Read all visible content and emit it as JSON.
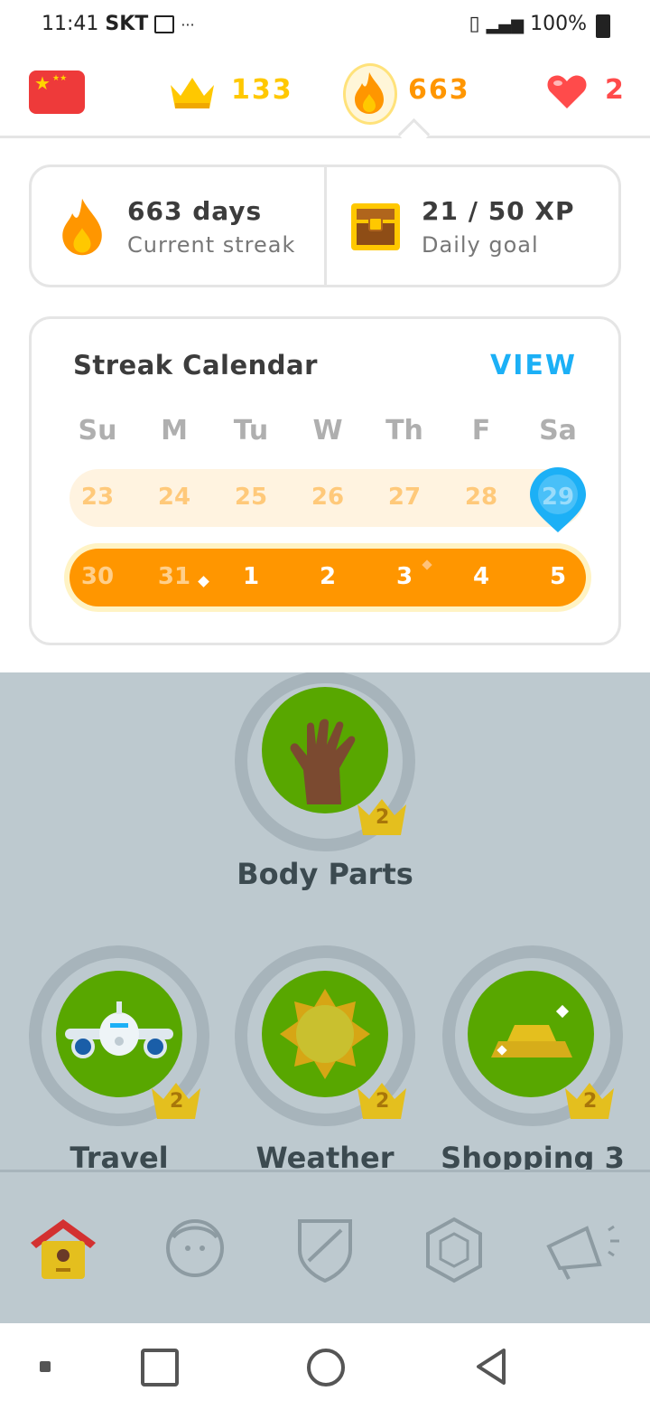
{
  "status": {
    "time": "11:41",
    "carrier": "SKT",
    "battery": "100%"
  },
  "top": {
    "crowns": "133",
    "streak": "663",
    "hearts": "2"
  },
  "streak_card": {
    "days": "663 days",
    "days_label": "Current streak",
    "xp": "21 / 50 XP",
    "xp_label": "Daily goal"
  },
  "calendar": {
    "title": "Streak Calendar",
    "view": "VIEW",
    "days": [
      "Su",
      "M",
      "Tu",
      "W",
      "Th",
      "F",
      "Sa"
    ],
    "week1": [
      "23",
      "24",
      "25",
      "26",
      "27",
      "28",
      "29"
    ],
    "week2": [
      "30",
      "31",
      "1",
      "2",
      "3",
      "4",
      "5"
    ]
  },
  "skills": [
    {
      "title": "Body Parts",
      "level": "2",
      "icon": "hand-icon"
    },
    {
      "title": "Travel",
      "level": "2",
      "icon": "airplane-icon"
    },
    {
      "title": "Weather",
      "level": "2",
      "icon": "sun-icon"
    },
    {
      "title": "Shopping 3",
      "level": "2",
      "icon": "gold-bars-icon"
    }
  ],
  "tabs": [
    "home-icon",
    "profile-icon",
    "league-shield-icon",
    "shop-gem-icon",
    "news-megaphone-icon"
  ],
  "colors": {
    "orange": "#ff9600",
    "gold": "#ffc800",
    "red": "#ff4b4b",
    "blue": "#1cb0f6",
    "green": "#58a700"
  }
}
